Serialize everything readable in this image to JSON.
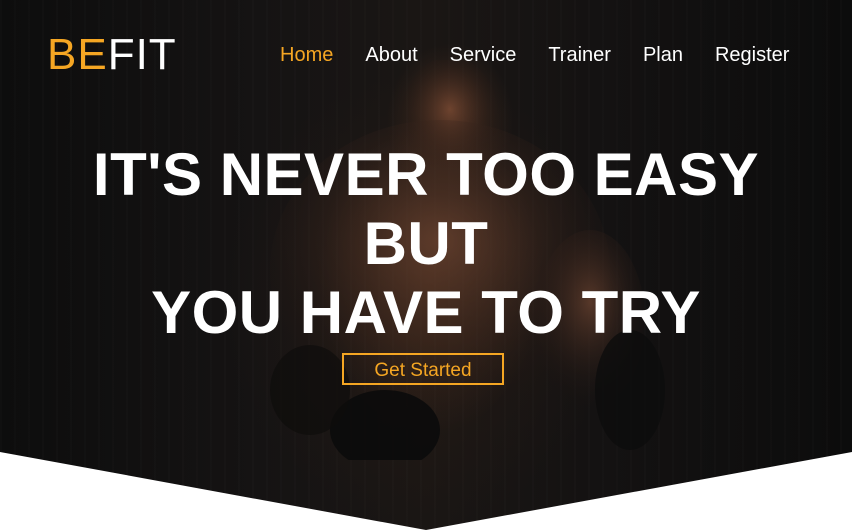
{
  "brand": {
    "accent_part": "BE",
    "rest_part": "FIT",
    "accent_color": "#f5a623"
  },
  "nav": {
    "items": [
      {
        "label": "Home",
        "active": true
      },
      {
        "label": "About",
        "active": false
      },
      {
        "label": "Service",
        "active": false
      },
      {
        "label": "Trainer",
        "active": false
      },
      {
        "label": "Plan",
        "active": false
      },
      {
        "label": "Register",
        "active": false
      }
    ]
  },
  "hero": {
    "headline_line1": "IT'S NEVER TOO EASY",
    "headline_line2": "BUT",
    "headline_line3": "YOU HAVE TO TRY",
    "cta_label": "Get Started"
  }
}
